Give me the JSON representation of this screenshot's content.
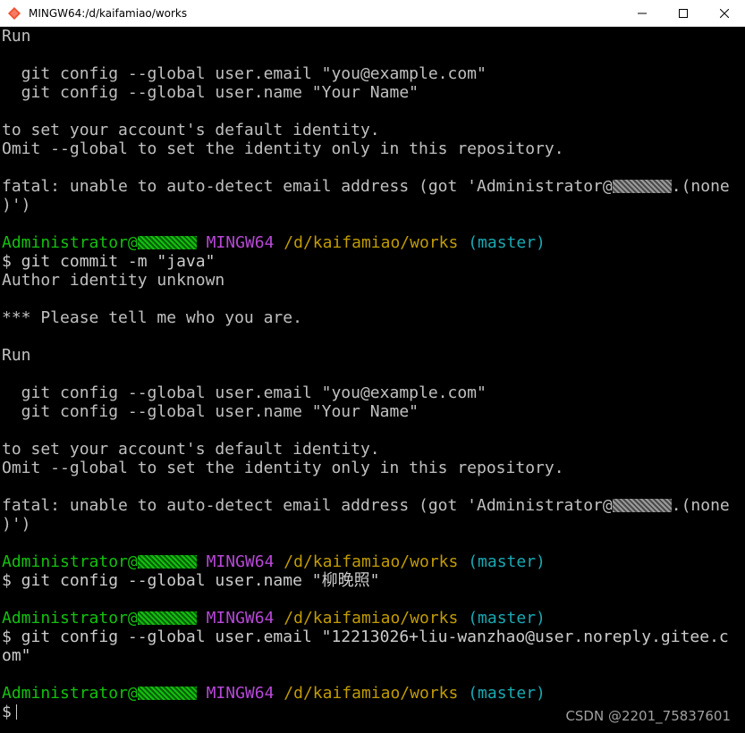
{
  "window": {
    "title": "MINGW64:/d/kaifamiao/works",
    "icons": [
      "git-bash-icon",
      "minimize-icon",
      "maximize-icon",
      "close-icon"
    ]
  },
  "terminal": {
    "colors": {
      "background": "#000000",
      "text": "#c0c0c0",
      "user": "#13c10e",
      "system": "#b648d6",
      "path": "#c19c00",
      "branch": "#1aa9b3"
    },
    "lines": {
      "l1": "Run",
      "l2": "",
      "l3": "  git config --global user.email \"you@example.com\"",
      "l4": "  git config --global user.name \"Your Name\"",
      "l5": "",
      "l6": "to set your account's default identity.",
      "l7": "Omit --global to set the identity only in this repository.",
      "l8": "",
      "l9_a": "fatal: unable to auto-detect email address (got 'Administrator@",
      "l9_b": ".(none",
      "l10": ")')",
      "l11": "",
      "p1_user": "Administrator@",
      "p1_sys": "MINGW64",
      "p1_path": "/d/kaifamiao/works",
      "p1_branch": "(master)",
      "c1": "$ git commit -m \"java\"",
      "l13": "Author identity unknown",
      "l14": "",
      "l15": "*** Please tell me who you are.",
      "l16": "",
      "l17": "Run",
      "l18": "",
      "l19": "  git config --global user.email \"you@example.com\"",
      "l20": "  git config --global user.name \"Your Name\"",
      "l21": "",
      "l22": "to set your account's default identity.",
      "l23": "Omit --global to set the identity only in this repository.",
      "l24": "",
      "l25_a": "fatal: unable to auto-detect email address (got 'Administrator@",
      "l25_b": ".(none",
      "l26": ")')",
      "l27": "",
      "p2_user": "Administrator@",
      "p2_sys": "MINGW64",
      "p2_path": "/d/kaifamiao/works",
      "p2_branch": "(master)",
      "c2": "$ git config --global user.name \"柳晚照\"",
      "l30": "",
      "p3_user": "Administrator@",
      "p3_sys": "MINGW64",
      "p3_path": "/d/kaifamiao/works",
      "p3_branch": "(master)",
      "c3a": "$ git config --global user.email \"12213026+liu-wanzhao@user.noreply.gitee.c",
      "c3b": "om\"",
      "l34": "",
      "p4_user": "Administrator@",
      "p4_sys": "MINGW64",
      "p4_path": "/d/kaifamiao/works",
      "p4_branch": "(master)",
      "prompt_final": "$"
    }
  },
  "watermark": "CSDN @2201_75837601"
}
